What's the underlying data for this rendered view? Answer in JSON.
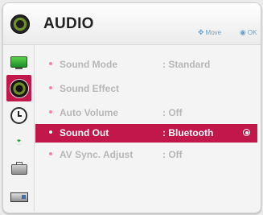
{
  "header": {
    "title": "AUDIO",
    "icon": "speaker-icon",
    "hint_move_glyph": "✥",
    "hint_move_label": "Move",
    "hint_ok_glyph": "◉",
    "hint_ok_label": "OK"
  },
  "sidebar": {
    "items": [
      {
        "icon": "monitor-icon",
        "active": false
      },
      {
        "icon": "speaker-icon",
        "active": true
      },
      {
        "icon": "clock-icon",
        "active": false
      },
      {
        "icon": "wifi-icon",
        "active": false
      },
      {
        "icon": "briefcase-icon",
        "active": false
      },
      {
        "icon": "input-device-icon",
        "active": false
      }
    ]
  },
  "menu": {
    "items": [
      {
        "label": "Sound Mode",
        "value": ": Standard",
        "selected": false
      },
      {
        "label": "Sound Effect",
        "value": "",
        "selected": false
      },
      {
        "label": "Auto Volume",
        "value": ": Off",
        "selected": false
      },
      {
        "label": "Sound Out",
        "value": ": Bluetooth",
        "selected": true
      },
      {
        "label": "AV Sync. Adjust",
        "value": ": Off",
        "selected": false
      }
    ]
  },
  "colors": {
    "accent": "#c2174b",
    "inactive_text": "#b7b7b7",
    "hint_text": "#6aa0c8"
  }
}
